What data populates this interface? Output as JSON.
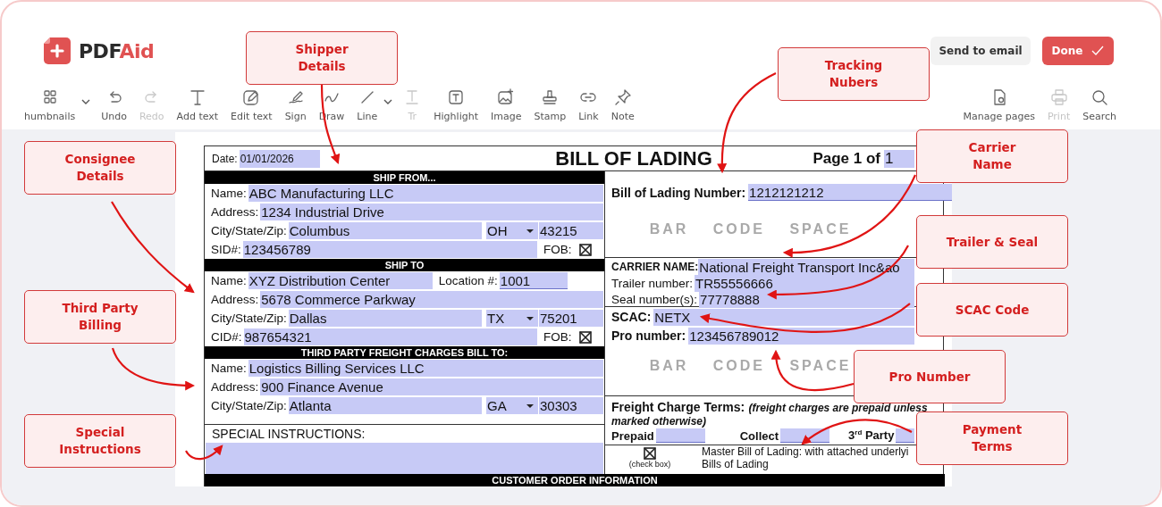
{
  "app": {
    "logo": {
      "dark": "PDF",
      "accent": "Aid"
    },
    "actions": [
      {
        "label": "Send to email",
        "kind": "secondary"
      },
      {
        "label": "Done",
        "kind": "primary"
      }
    ]
  },
  "toolbar": {
    "left": [
      {
        "kind": "thumbnails",
        "label": "humbnails",
        "disabled": false,
        "menu": true
      },
      {
        "kind": "undo",
        "label": "Undo",
        "disabled": false,
        "menu": false
      },
      {
        "kind": "redo",
        "label": "Redo",
        "disabled": true,
        "menu": false
      },
      {
        "kind": "text",
        "label": "Add text",
        "disabled": false,
        "menu": false
      },
      {
        "kind": "edit",
        "label": "Edit text",
        "disabled": false,
        "menu": false
      },
      {
        "kind": "sign",
        "label": "Sign",
        "disabled": false,
        "menu": false
      },
      {
        "kind": "draw",
        "label": "Draw",
        "disabled": false,
        "menu": false
      },
      {
        "kind": "line",
        "label": "Line",
        "disabled": false,
        "menu": true
      },
      {
        "kind": "textcolor",
        "label": "Tr",
        "disabled": true,
        "menu": false
      },
      {
        "kind": "highlight",
        "label": "Highlight",
        "disabled": false,
        "menu": false
      },
      {
        "kind": "image",
        "label": "Image",
        "disabled": false,
        "menu": false
      },
      {
        "kind": "stamp",
        "label": "Stamp",
        "disabled": false,
        "menu": false
      },
      {
        "kind": "link",
        "label": "Link",
        "disabled": false,
        "menu": false
      },
      {
        "kind": "note",
        "label": "Note",
        "disabled": false,
        "menu": false
      }
    ],
    "right": [
      {
        "kind": "pages",
        "label": "Manage pages",
        "disabled": false,
        "menu": false
      },
      {
        "kind": "print",
        "label": "Print",
        "disabled": true,
        "menu": false
      },
      {
        "kind": "search",
        "label": "Search",
        "disabled": false,
        "menu": false
      }
    ]
  },
  "document": {
    "date_label": "Date:",
    "date": "01/01/2026",
    "title": "BILL OF LADING",
    "page_label": "Page 1 of",
    "page_total": "1",
    "ship_from": {
      "header": "SHIP FROM...",
      "name_label": "Name:",
      "name": "ABC Manufacturing LLC",
      "address_label": "Address:",
      "address": "1234 Industrial Drive",
      "csz_label": "City/State/Zip:",
      "city": "Columbus",
      "state": "OH",
      "zip": "43215",
      "id_label": "SID#:",
      "id": "123456789",
      "fob_label": "FOB:",
      "fob_checked": true
    },
    "ship_to": {
      "header": "SHIP TO",
      "name_label": "Name:",
      "name": "XYZ Distribution Center",
      "location_label": "Location #:",
      "location": "1001",
      "address_label": "Address:",
      "address": "5678 Commerce Parkway",
      "csz_label": "City/State/Zip:",
      "city": "Dallas",
      "state": "TX",
      "zip": "75201",
      "id_label": "CID#:",
      "id": "987654321",
      "fob_label": "FOB:",
      "fob_checked": true
    },
    "third_party": {
      "header": "THIRD PARTY FREIGHT CHARGES BILL TO:",
      "name_label": "Name:",
      "name": "Logistics Billing Services LLC",
      "address_label": "Address:",
      "address": "900 Finance Avenue",
      "csz_label": "City/State/Zip:",
      "city": "Atlanta",
      "state": "GA",
      "zip": "30303"
    },
    "special_label": "SPECIAL INSTRUCTIONS:",
    "footer_bar": "CUSTOMER ORDER INFORMATION",
    "bol_label": "Bill of Lading Number:",
    "bol_number": "1212121212",
    "barcode_top": "BAR CODE SPACE",
    "carrier_label": "CARRIER NAME:",
    "carrier": "National Freight Transport Inc&ao",
    "trailer_label": "Trailer number:",
    "trailer": "TR55556666",
    "seal_label": "Seal number(s):",
    "seal": "77778888",
    "scac_label": "SCAC:",
    "scac": "NETX",
    "pro_label": "Pro number:",
    "pro": "123456789012",
    "barcode_bottom": "BAR CODE SPACE",
    "terms_label": "Freight Charge Terms:",
    "terms_note": "(freight charges are prepaid unless marked otherwise)",
    "prepaid_label": "Prepaid",
    "collect_label": "Collect",
    "third_label": "3$^{rd}$ Party",
    "master_checked": true,
    "check_caption": "(check box)",
    "master_lines": [
      "Master Bill of Lading: with attached underlyi",
      "Bills of Lading"
    ]
  },
  "callouts": [
    {
      "text": "Shipper\nDetails"
    },
    {
      "text": "Tracking\nNubers"
    },
    {
      "text": "Consignee\nDetails"
    },
    {
      "text": "Carrier\nName"
    },
    {
      "text": "Trailer & Seal"
    },
    {
      "text": "SCAC Code"
    },
    {
      "text": "Third Party\nBilling"
    },
    {
      "text": "Pro Number"
    },
    {
      "text": "Special\nInstructions"
    },
    {
      "text": "Payment\nTerms"
    }
  ]
}
